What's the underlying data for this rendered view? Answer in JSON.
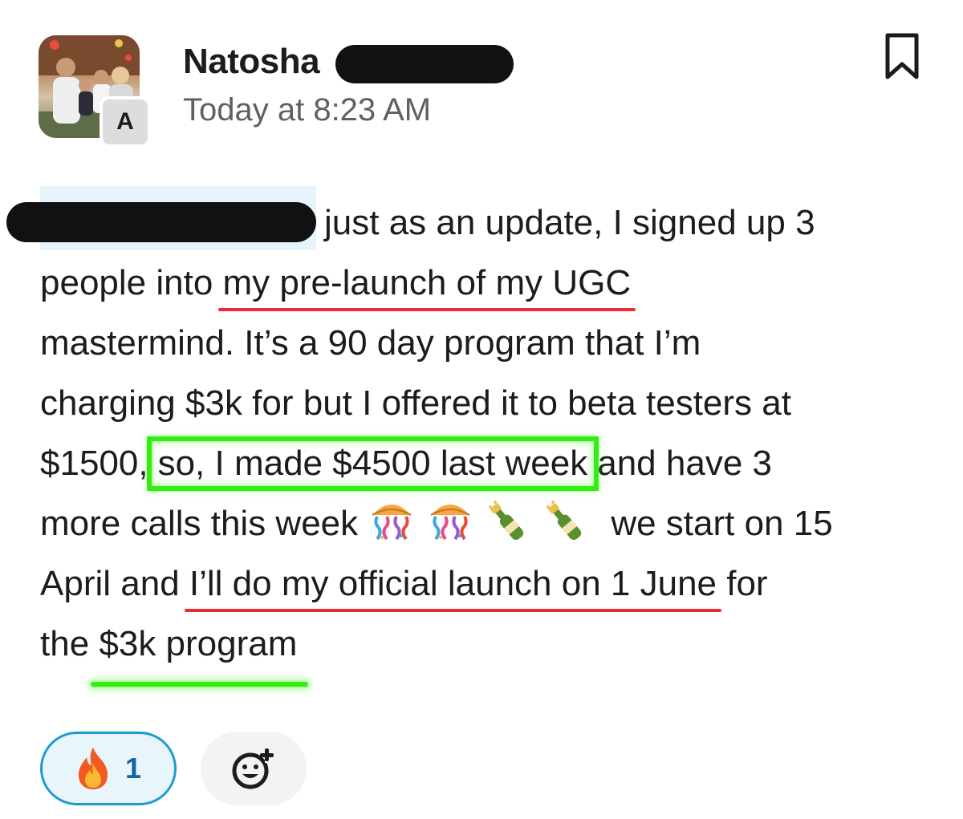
{
  "message": {
    "sender": "Natosha",
    "timestamp": "Today at 8:23 AM",
    "avatar_badge": "A",
    "body": {
      "line1_text": "just as an update, I signed up 3",
      "line2_pre": "people into ",
      "line2_underlined": "my pre-launch of my UGC",
      "line3": "mastermind. It’s a 90 day program that I’m",
      "line4": "charging $3k for but I offered it to beta testers at",
      "line5_pre": "$1500,",
      "line5_boxed": "so, I made $4500 last week",
      "line5_post": "and have 3",
      "line6_pre": "more calls this week",
      "line6_post": "we start on 15",
      "line7_pre": "April and ",
      "line7_underlined": "I’ll do my official launch on 1 June",
      "line7_post": " for",
      "line8_pre": "the ",
      "line8_underlined": "$3k program"
    },
    "emojis": [
      "confetti-ball-icon",
      "confetti-ball-icon",
      "champagne-icon",
      "champagne-icon"
    ]
  },
  "reactions": [
    {
      "emoji": "fire-icon",
      "count": "1"
    }
  ],
  "colors": {
    "red_underline": "#ee2a34",
    "green_highlight": "#33ee11",
    "reaction_border": "#1d9bd1",
    "reaction_count": "#1264a3",
    "mention_bg": "#e8f4fb"
  }
}
